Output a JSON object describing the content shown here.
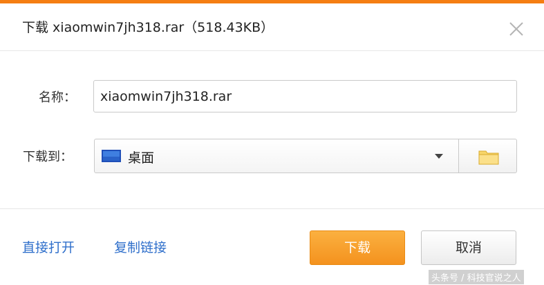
{
  "title_bar": {
    "title": "下载 xiaomwin7jh318.rar（518.43KB）",
    "close_icon": "close-icon",
    "accent_color": "#f57e12"
  },
  "form": {
    "name_label": "名称：",
    "name_value": "xiaomwin7jh318.rar",
    "saveto_label": "下载到：",
    "location_value": "桌面",
    "location_icon": "desktop-icon",
    "browse_icon": "folder-icon"
  },
  "footer": {
    "open_link": "直接打开",
    "copy_link": "复制链接",
    "download_label": "下载",
    "cancel_label": "取消",
    "link_color": "#2f6fcb",
    "primary_color": "#f4921e"
  },
  "watermark": "头条号 / 科技官说之人"
}
